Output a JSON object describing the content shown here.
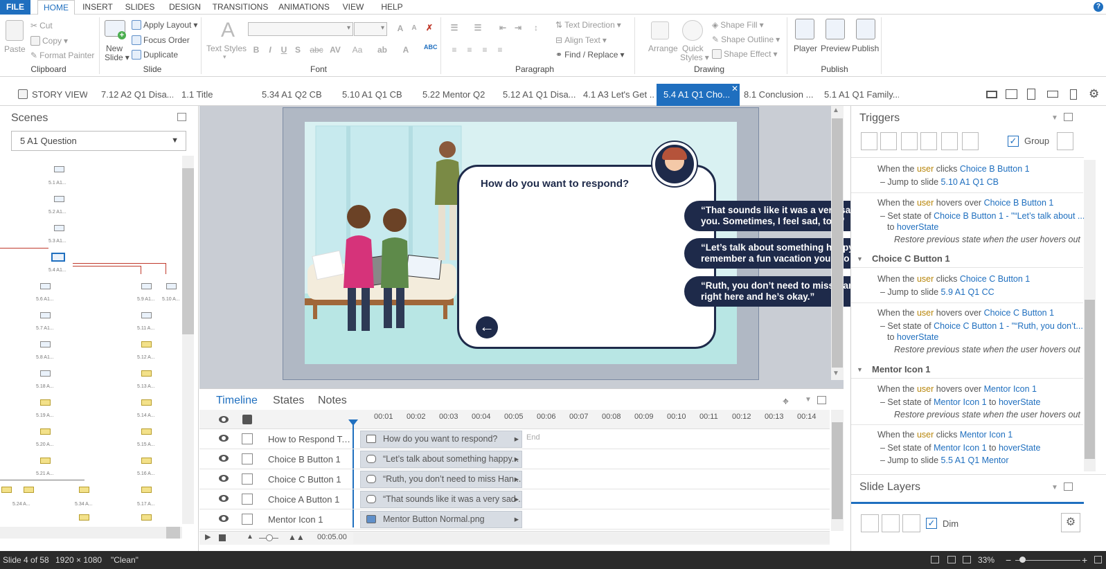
{
  "menubar": {
    "items": [
      "FILE",
      "HOME",
      "INSERT",
      "SLIDES",
      "DESIGN",
      "TRANSITIONS",
      "ANIMATIONS",
      "VIEW",
      "HELP"
    ],
    "active": "HOME"
  },
  "ribbon": {
    "clipboard": {
      "paste": "Paste",
      "cut": "Cut",
      "copy": "Copy",
      "format_painter": "Format Painter",
      "label": "Clipboard"
    },
    "slide": {
      "new_slide_line1": "New",
      "new_slide_line2": "Slide",
      "apply_layout": "Apply Layout",
      "focus_order": "Focus Order",
      "duplicate": "Duplicate",
      "label": "Slide"
    },
    "font": {
      "text_styles": "Text Styles",
      "label": "Font",
      "bold": "B",
      "italic": "I",
      "underline": "U",
      "strike": "S",
      "abc": "abc",
      "aa": "Aa"
    },
    "paragraph": {
      "text_direction": "Text Direction",
      "align_text": "Align Text",
      "find_replace": "Find / Replace",
      "label": "Paragraph"
    },
    "drawing": {
      "arrange": "Arrange",
      "quick_styles_line1": "Quick",
      "quick_styles_line2": "Styles",
      "shape_fill": "Shape Fill",
      "shape_outline": "Shape Outline",
      "shape_effect": "Shape Effect",
      "label": "Drawing"
    },
    "publish": {
      "player": "Player",
      "preview": "Preview",
      "publish": "Publish",
      "label": "Publish"
    }
  },
  "tabs": {
    "story_view": "STORY VIEW",
    "items": [
      "7.12 A2 Q1 Disa...",
      "1.1 Title",
      "5.34 A1 Q2 CB",
      "5.10 A1 Q1 CB",
      "5.22 Mentor Q2",
      "5.12 A1 Q1 Disa...",
      "4.1 A3 Let's Get ...",
      "5.4 A1 Q1 Cho...",
      "8.1 Conclusion ...",
      "5.1 A1 Q1 Family..."
    ],
    "active_index": 7
  },
  "scenes": {
    "title": "Scenes",
    "selected": "5 A1 Question",
    "thumbs_left": [
      "5.1 A1...",
      "5.2 A1...",
      "5.3 A1...",
      "5.4 A1...",
      "5.6 A1...",
      "5.7 A1...",
      "5.8 A1...",
      "5.18 A...",
      "5.19 A...",
      "5.20 A...",
      "5.21 A..."
    ],
    "thumbs_right": [
      "5.9 A1...",
      "5.10 A...",
      "5.11 A...",
      "5.12 A...",
      "5.13 A...",
      "5.14 A...",
      "5.15 A...",
      "5.16 A...",
      "5.17 A..."
    ],
    "thumbs_bottom": [
      "5.24 A...",
      "5.34 A..."
    ]
  },
  "slide": {
    "question": "How do you want to respond?",
    "choices": [
      "“That sounds like it was a very sad time for you. Sometimes, I feel sad, too.”",
      "“Let’s talk about something happy. Do you remember a fun vacation you two had?”",
      "“Ruth, you don’t need to miss Hank. He’s right here and he’s okay.”"
    ],
    "colors": {
      "button_bg": "#1e2a4a",
      "slide_bg": "#d9f1f2",
      "panel_bg": "#ffffff"
    }
  },
  "timeline": {
    "tabs": [
      "Timeline",
      "States",
      "Notes"
    ],
    "active_tab": "Timeline",
    "ticks": [
      "00:01",
      "00:02",
      "00:03",
      "00:04",
      "00:05",
      "00:06",
      "00:07",
      "00:08",
      "00:09",
      "00:10",
      "00:11",
      "00:12",
      "00:13",
      "00:14"
    ],
    "end_label": "End",
    "rows": [
      {
        "name": "How to Respond Tex...",
        "bar": "How do you want to respond?"
      },
      {
        "name": "Choice B Button 1",
        "bar": "“Let’s talk about something happy..."
      },
      {
        "name": "Choice C Button 1",
        "bar": "“Ruth, you don’t need to miss Han..."
      },
      {
        "name": "Choice A Button 1",
        "bar": "“That sounds like it was a very sad ..."
      },
      {
        "name": "Mentor Icon 1",
        "bar": "Mentor Button Normal.png"
      }
    ],
    "duration": "00:05.00"
  },
  "triggers": {
    "title": "Triggers",
    "group_label": "Group",
    "t1": {
      "a": "When the ",
      "b": "user",
      "c": " clicks ",
      "d": "Choice B Button 1",
      "e": "– Jump to slide ",
      "f": "5.10 A1 Q1 CB"
    },
    "t2": {
      "a": "When the ",
      "b": "user",
      "c": " hovers over ",
      "d": "Choice B Button 1",
      "e": "– Set state of ",
      "f": "Choice B Button 1 - \"“Let’s talk about ...",
      "g": "to ",
      "h": "hoverState",
      "i": "Restore previous state when the user hovers out"
    },
    "g_c": "Choice C Button 1",
    "t3": {
      "a": "When the ",
      "b": "user",
      "c": " clicks ",
      "d": "Choice C Button 1",
      "e": "– Jump to slide ",
      "f": "5.9 A1 Q1 CC"
    },
    "t4": {
      "a": "When the ",
      "b": "user",
      "c": " hovers over ",
      "d": "Choice C Button 1",
      "e": "– Set state of ",
      "f": "Choice C Button 1 - \"“Ruth, you don’t...",
      "g": "to ",
      "h": "hoverState",
      "i": "Restore previous state when the user hovers out"
    },
    "g_m": "Mentor Icon 1",
    "t5": {
      "a": "When the ",
      "b": "user",
      "c": " hovers over ",
      "d": "Mentor Icon 1",
      "e": "– Set state of ",
      "f": "Mentor Icon 1",
      "g": " to ",
      "h": "hoverState",
      "i": "Restore previous state when the user hovers out"
    },
    "t6": {
      "a": "When the ",
      "b": "user",
      "c": " clicks ",
      "d": "Mentor Icon 1",
      "e": "– Set state of ",
      "f": "Mentor Icon 1",
      "g": " to ",
      "h": "hoverState",
      "j": "– Jump to slide ",
      "k": "5.5 A1 Q1 Mentor"
    }
  },
  "layers": {
    "title": "Slide Layers",
    "dim": "Dim"
  },
  "status": {
    "slide": "Slide 4 of 58",
    "size": "1920 × 1080",
    "theme": "\"Clean\"",
    "zoom": "33%"
  }
}
